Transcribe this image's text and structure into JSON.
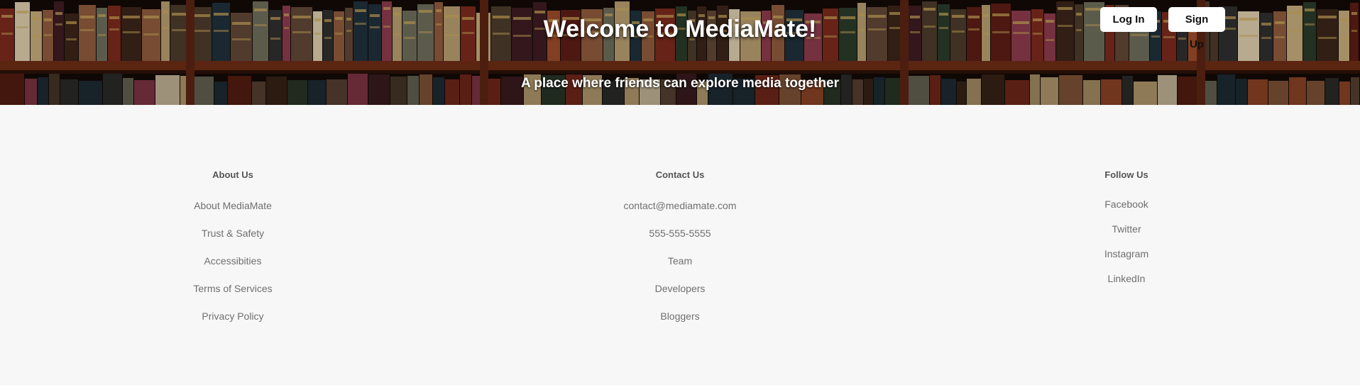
{
  "hero": {
    "title": "Welcome to MediaMate!",
    "subtitle": "A place where friends can explore media together"
  },
  "auth": {
    "login_label": "Log In",
    "signup_label": "Sign Up"
  },
  "footer": {
    "about": {
      "heading": "About Us",
      "links": [
        "About MediaMate",
        "Trust & Safety",
        "Accessibities",
        "Terms of Services",
        "Privacy Policy"
      ]
    },
    "contact": {
      "heading": "Contact Us",
      "links": [
        "contact@mediamate.com",
        "555-555-5555",
        "Team",
        "Developers",
        "Bloggers"
      ]
    },
    "follow": {
      "heading": "Follow Us",
      "links": [
        "Facebook",
        "Twitter",
        "Instagram",
        "LinkedIn"
      ]
    }
  },
  "colors": {
    "footer_bg": "#f7f7f7",
    "link_text": "#6f6f6f",
    "heading_text": "#555555",
    "button_bg": "#ffffff"
  }
}
